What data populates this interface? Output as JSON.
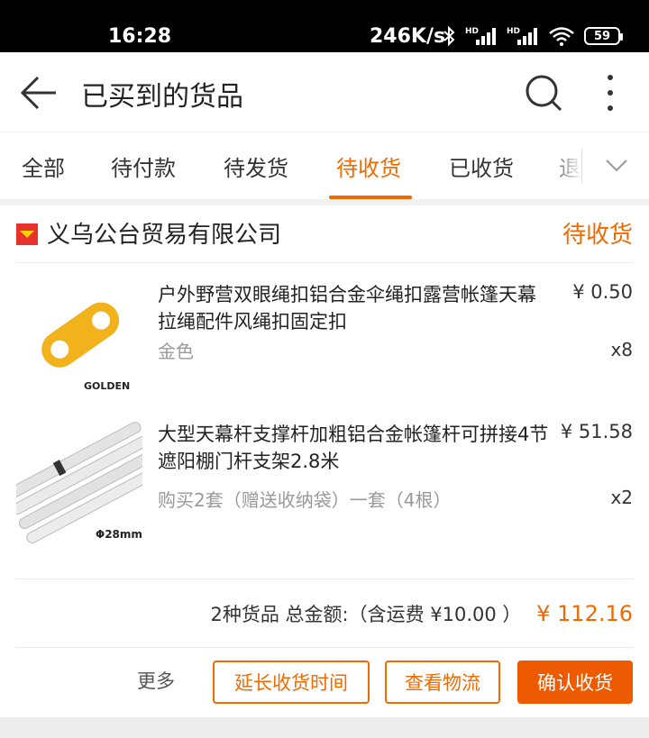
{
  "status_bar": {
    "time": "16:28",
    "network_speed": "246K/s",
    "battery": "59"
  },
  "header": {
    "title": "已买到的货品"
  },
  "tabs": [
    {
      "label": "全部"
    },
    {
      "label": "待付款"
    },
    {
      "label": "待发货"
    },
    {
      "label": "待收货",
      "active": true
    },
    {
      "label": "已收货"
    },
    {
      "label": "退"
    }
  ],
  "order": {
    "shop_name": "义乌公台贸易有限公司",
    "status": "待收货",
    "items": [
      {
        "title": "户外野营双眼绳扣铝合金伞绳扣露营帐篷天幕拉绳配件风绳扣固定扣",
        "spec": "金色",
        "price": "¥ 0.50",
        "qty": "x8",
        "thumb_label": "GOLDEN"
      },
      {
        "title": "大型天幕杆支撑杆加粗铝合金帐篷杆可拼接4节遮阳棚门杆支架2.8米",
        "spec": "购买2套（赠送收纳袋）一套（4根）",
        "price": "¥ 51.58",
        "qty": "x2",
        "thumb_label": "Φ28mm"
      }
    ],
    "summary_text": "2种货品 总金额:（含运费 ¥10.00 ）",
    "total": "¥ 112.16"
  },
  "actions": {
    "more": "更多",
    "extend": "延长收货时间",
    "logistics": "查看物流",
    "confirm": "确认收货"
  },
  "colors": {
    "accent": "#f06a00",
    "primary_button": "#ee5a00"
  }
}
